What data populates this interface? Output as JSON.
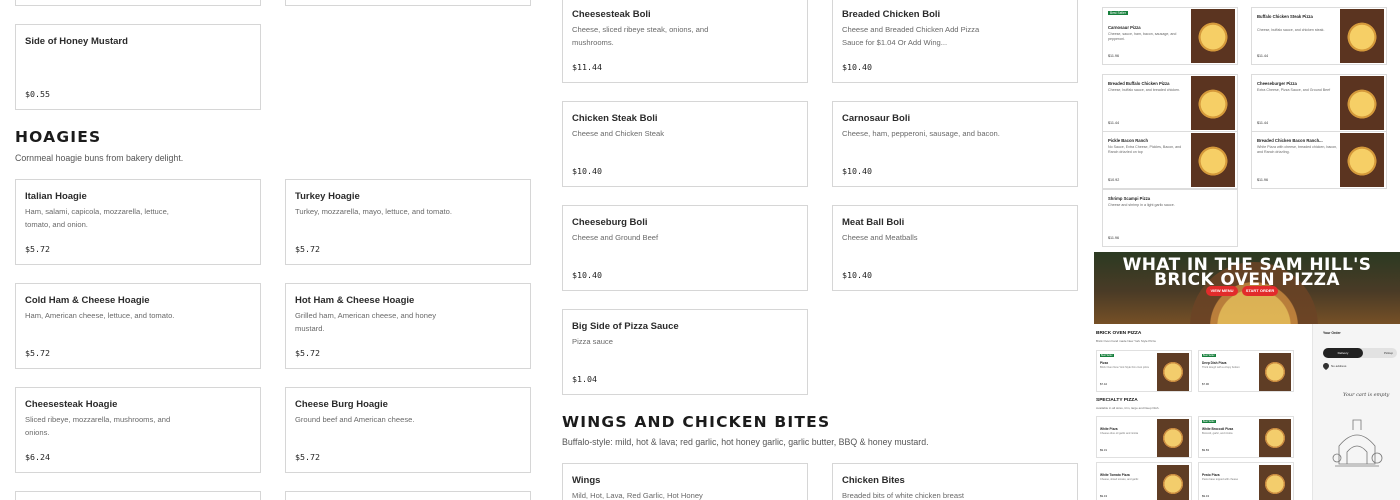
{
  "left_column": {
    "top_items": [
      {
        "name": "Side of Honey Mustard",
        "description": "",
        "price": "$0.55"
      }
    ],
    "hoagies": {
      "title": "HOAGIES",
      "subtitle": "Cornmeal hoagie buns from bakery delight.",
      "items": [
        {
          "name": "Italian Hoagie",
          "description": "Ham, salami, capicola, mozzarella, lettuce, tomato, and onion.",
          "price": "$5.72"
        },
        {
          "name": "Turkey Hoagie",
          "description": "Turkey, mozzarella, mayo, lettuce, and tomato.",
          "price": "$5.72"
        },
        {
          "name": "Cold Ham & Cheese Hoagie",
          "description": "Ham, American cheese, lettuce, and tomato.",
          "price": "$5.72"
        },
        {
          "name": "Hot Ham & Cheese Hoagie",
          "description": "Grilled ham, American cheese, and honey mustard.",
          "price": "$5.72"
        },
        {
          "name": "Cheesesteak Hoagie",
          "description": "Sliced ribeye, mozzarella, mushrooms, and onions.",
          "price": "$6.24"
        },
        {
          "name": "Cheese Burg Hoagie",
          "description": "Ground beef and American cheese.",
          "price": "$5.72"
        }
      ]
    }
  },
  "middle_column": {
    "bolis": [
      {
        "name": "Cheesesteak Boli",
        "description": "Cheese, sliced ribeye steak, onions, and mushrooms.",
        "price": "$11.44"
      },
      {
        "name": "Breaded Chicken Boli",
        "description": "Cheese and Breaded Chicken Add Pizza Sauce for $1.04 Or Add Wing...",
        "price": "$10.40"
      },
      {
        "name": "Chicken Steak Boli",
        "description": "Cheese and Chicken Steak",
        "price": "$10.40"
      },
      {
        "name": "Carnosaur Boli",
        "description": "Cheese, ham, pepperoni, sausage, and bacon.",
        "price": "$10.40"
      },
      {
        "name": "Cheeseburg Boli",
        "description": "Cheese and Ground Beef",
        "price": "$10.40"
      },
      {
        "name": "Meat Ball Boli",
        "description": "Cheese and Meatballs",
        "price": "$10.40"
      },
      {
        "name": "Big Side of Pizza Sauce",
        "description": "Pizza sauce",
        "price": "$1.04"
      }
    ],
    "wings": {
      "title": "WINGS AND CHICKEN BITES",
      "subtitle": "Buffalo-style: mild, hot & lava; red garlic, hot honey garlic, garlic butter, BBQ & honey mustard.",
      "items": [
        {
          "name": "Wings",
          "description": "Mild, Hot, Lava, Red Garlic, Hot Honey",
          "price": ""
        },
        {
          "name": "Chicken Bites",
          "description": "Breaded bits of white chicken breast",
          "price": ""
        }
      ]
    }
  },
  "preview": {
    "thumbs": [
      {
        "badge": "Best Seller",
        "name": "Carnosaur Pizza",
        "description": "Cheese, sauce, ham, bacon, sausage, and pepperoni.",
        "price": "$11.96"
      },
      {
        "badge": "",
        "name": "Buffalo Chicken Steak Pizza",
        "description": "Cheese, buffalo sauce, and chicken steak.",
        "price": "$11.44"
      },
      {
        "badge": "",
        "name": "Breaded Buffalo Chicken Pizza",
        "description": "Cheese, buffalo sauce, and breaded chicken.",
        "price": "$11.44"
      },
      {
        "badge": "",
        "name": "Cheeseburger Pizza",
        "description": "Extra Cheese, Pizza Sauce, and Ground Beef",
        "price": "$11.44"
      },
      {
        "badge": "",
        "name": "Pickle Bacon Ranch",
        "description": "No Sauce, Extra Cheese, Pickles, Bacon, and Ranch drizzled on top",
        "price": "$10.92"
      },
      {
        "badge": "",
        "name": "Breaded Chicken Bacon Ranch...",
        "description": "White Pizza with cheese, breaded chicken, bacon, and Ranch drizzling.",
        "price": "$11.96"
      },
      {
        "badge": "",
        "name": "Shrimp Scampi Pizza",
        "description": "Cheese and shrimp in a light garlic sauce.",
        "price": "$11.96"
      }
    ],
    "hero": {
      "line1": "WHAT IN THE SAM HILL'S",
      "line2": "BRICK OVEN PIZZA",
      "btn_menu": "VIEW MENU",
      "btn_order": "START ORDER"
    },
    "page2": {
      "section1_title": "BRICK OVEN PIZZA",
      "section1_sub": "Brick Oven hand made New York Style Pizza",
      "section2_title": "SPECIALTY PIZZA",
      "section2_sub": "Available in all sizes, trim, large and Deep Dish.",
      "minis": [
        {
          "badge": "Best Seller",
          "name": "Pizza",
          "description": "Brick Oven New York Style thin crust pizza",
          "price": "$7.42"
        },
        {
          "badge": "Best Seller",
          "name": "Deep Dish Pizza",
          "description": "Thick dough with a crispy bottom",
          "price": "$7.90"
        },
        {
          "badge": "",
          "name": "White Pizza",
          "description": "Cheese olive oil garlic and ricotta",
          "price": "$9.31"
        },
        {
          "badge": "Best Seller",
          "name": "White Broccoli Pizza",
          "description": "Broccoli, garlic, and ricotta",
          "price": "$9.83"
        },
        {
          "badge": "",
          "name": "White Tomato Pizza",
          "description": "Cheese, sliced tomato, and garlic",
          "price": "$9.43"
        },
        {
          "badge": "",
          "name": "Pesto Pizza",
          "description": "Pesto base topped with cheese",
          "price": "$9.43"
        }
      ],
      "cart": {
        "title": "Your Order",
        "delivery": "Delivery",
        "pickup": "Pickup",
        "address": "No address",
        "empty": "Your cart is empty"
      }
    }
  }
}
